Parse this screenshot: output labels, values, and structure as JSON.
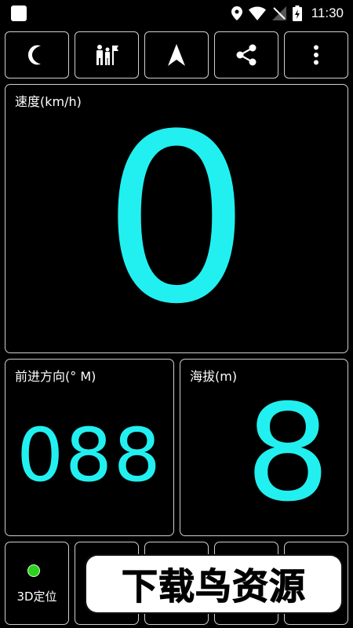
{
  "status_bar": {
    "time": "11:30",
    "icons": [
      "location-icon",
      "wifi-icon",
      "no-signal-icon",
      "battery-charging-icon"
    ]
  },
  "toolbar": {
    "buttons": [
      {
        "icon": "moon-icon",
        "action": "night-mode"
      },
      {
        "icon": "people-flag-icon",
        "action": "hud-people"
      },
      {
        "icon": "navigation-arrow-icon",
        "action": "navigate"
      },
      {
        "icon": "share-icon",
        "action": "share"
      },
      {
        "icon": "more-vert-icon",
        "action": "more"
      }
    ]
  },
  "speed": {
    "label": "速度(km/h)",
    "value": "0"
  },
  "heading": {
    "label": "前进方向(° M)",
    "value": "088"
  },
  "altitude": {
    "label": "海拔(m)",
    "value": "8"
  },
  "gps": {
    "label": "3D定位",
    "status_color": "#2bd31d"
  },
  "watermark": {
    "text": "下载鸟资源"
  },
  "colors": {
    "accent": "#22f0f0",
    "border": "#cfcfcf",
    "background": "#000000"
  }
}
